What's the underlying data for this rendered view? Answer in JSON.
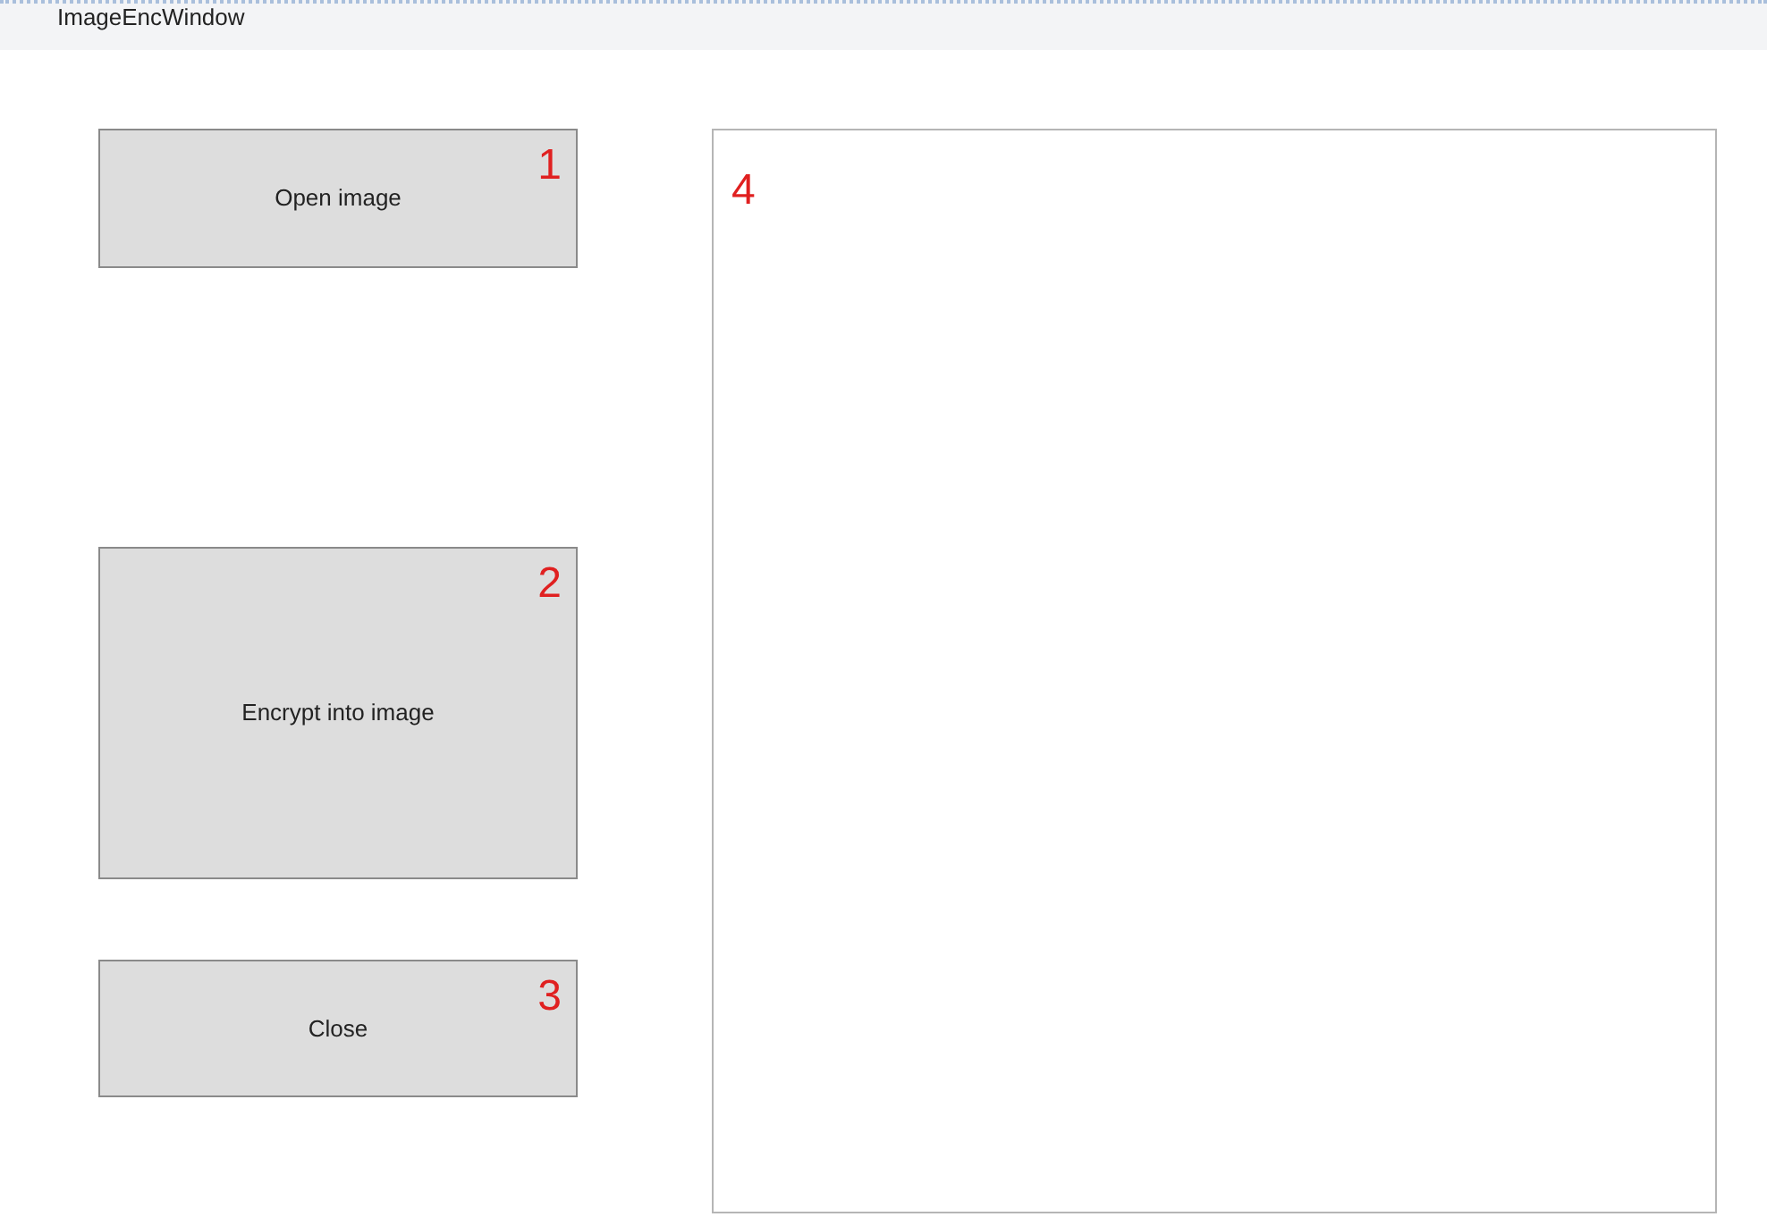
{
  "window": {
    "title": "ImageEncWindow"
  },
  "buttons": [
    {
      "label": "Open image",
      "annotation": "1"
    },
    {
      "label": "Encrypt into image",
      "annotation": "2"
    },
    {
      "label": "Close",
      "annotation": "3"
    }
  ],
  "image_panel": {
    "annotation": "4"
  }
}
